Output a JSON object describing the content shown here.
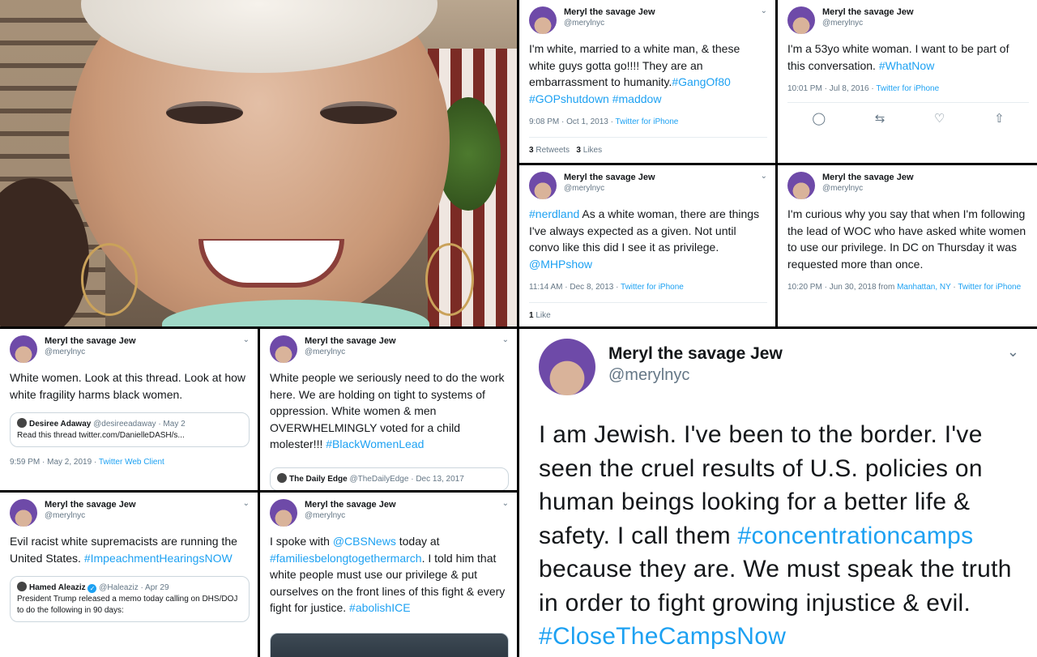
{
  "tweets": {
    "t1": {
      "name": "Meryl the savage Jew",
      "handle": "@merylnyc",
      "text": "I'm white, married to a white man, & these white guys gotta go!!!! They are an embarrassment to humanity.",
      "tags": [
        "#GangOf80",
        "#GOPshutdown",
        "#maddow"
      ],
      "time": "9:08 PM · Oct 1, 2013 · ",
      "client": "Twitter for iPhone",
      "retweets": "3",
      "retweets_label": "Retweets",
      "likes": "3",
      "likes_label": "Likes"
    },
    "t2": {
      "name": "Meryl the savage Jew",
      "handle": "@merylnyc",
      "text": "I'm a 53yo white woman. I want to be part of this conversation. ",
      "tag": "#WhatNow",
      "time": "10:01 PM · Jul 8, 2016 · ",
      "client": "Twitter for iPhone"
    },
    "t3": {
      "name": "Meryl the savage Jew",
      "handle": "@merylnyc",
      "tag": "#nerdland",
      "text": " As a white woman, there are things I've always expected as a given. Not until convo like this did I see it as privilege. ",
      "mention": "@MHPshow",
      "time": "11:14 AM · Dec 8, 2013 · ",
      "client": "Twitter for iPhone",
      "likes": "1",
      "likes_label": "Like"
    },
    "t4": {
      "name": "Meryl the savage Jew",
      "handle": "@merylnyc",
      "text": "I'm curious why you say that when I'm following the lead of WOC who have asked white women to use our privilege. In DC on Thursday it was requested more than once.",
      "time": "10:20 PM · Jun 30, 2018 from ",
      "location": "Manhattan, NY",
      "sep": " · ",
      "client": "Twitter for iPhone"
    },
    "t5": {
      "name": "Meryl the savage Jew",
      "handle": "@merylnyc",
      "text": "White women. Look at this thread. Look at how white fragility harms black women.",
      "quote_name": "Desiree Adaway",
      "quote_handle": "@desireeadaway · May 2",
      "quote_text": "Read this thread twitter.com/DanielleDASH/s...",
      "time": "9:59 PM · May 2, 2019 · ",
      "client": "Twitter Web Client"
    },
    "t6": {
      "name": "Meryl the savage Jew",
      "handle": "@merylnyc",
      "text": "White people we seriously need to do the work here. We are holding on tight to systems of oppression. White women & men OVERWHELMINGLY voted for a child molester!!! ",
      "tag": "#BlackWomenLead",
      "quote_name": "The Daily Edge",
      "quote_handle": "@TheDailyEdge · Dec 13, 2017"
    },
    "t7": {
      "name": "Meryl the savage Jew",
      "handle": "@merylnyc",
      "text": "Evil racist white supremacists are running the United States. ",
      "tag": "#ImpeachmentHearingsNOW",
      "quote_name": "Hamed Aleaziz",
      "quote_handle": "@Haleaziz · Apr 29",
      "quote_text": "President Trump released a memo today calling on DHS/DOJ to do the following in 90 days:"
    },
    "t8": {
      "name": "Meryl the savage Jew",
      "handle": "@merylnyc",
      "pre": "I spoke with ",
      "mention": "@CBSNews",
      "mid": " today at ",
      "tag1": "#familiesbelongtogethermarch",
      "text": ". I told him that white people must use our privilege & put ourselves on the front lines of this fight & every fight for justice. ",
      "tag2": "#abolishICE"
    },
    "t9": {
      "name": "Meryl the savage Jew",
      "handle": "@merylnyc",
      "text": "I am Jewish. I've been to the border. I've seen the cruel results of U.S. policies on human beings looking for a better life & safety. I call them ",
      "tag1": "#concentrationcamps",
      "text2": " because they are. We must speak the truth in order to fight growing injustice & evil. ",
      "tag2": "#CloseTheCampsNow"
    }
  },
  "icons": {
    "chevron": "chevron-down-icon",
    "reply": "reply-icon",
    "retweet": "retweet-icon",
    "like": "heart-icon",
    "share": "share-icon"
  },
  "colors": {
    "link": "#1da1f2",
    "muted": "#657786",
    "text": "#14171a"
  }
}
